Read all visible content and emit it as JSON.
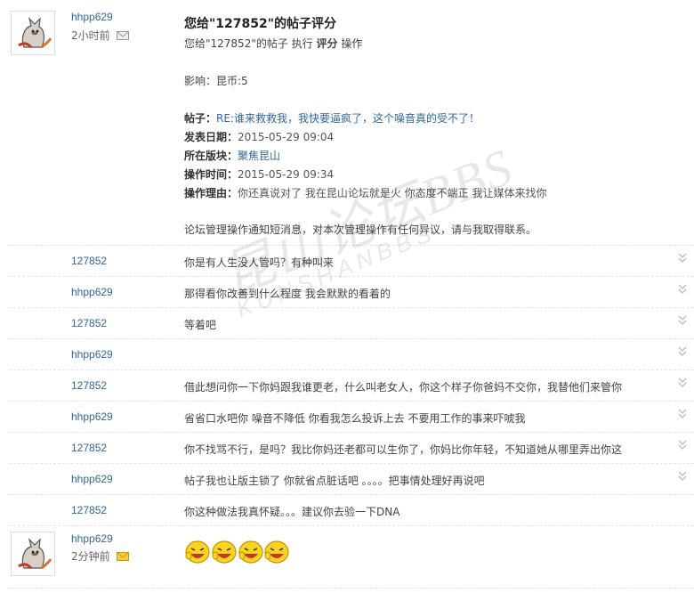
{
  "post1": {
    "username": "hhpp629",
    "time": "2小时前",
    "title": "您给\"127852\"的帖子评分",
    "subline_prefix": "您给\"127852\"的帖子 执行 ",
    "subline_action": "评分",
    "subline_suffix": " 操作",
    "impact": "影响：昆币:5",
    "fields": [
      {
        "key": "帖子：",
        "value": "RE:谁来救救我，我快要逼疯了，这个噪音真的受不了！",
        "link": true
      },
      {
        "key": "发表日期：",
        "value": "2015-05-29 09:04",
        "link": false
      },
      {
        "key": "所在版块：",
        "value": "聚焦昆山",
        "link": true
      },
      {
        "key": "操作时间：",
        "value": "2015-05-29 09:34",
        "link": false
      },
      {
        "key": "操作理由：",
        "value": "你还真说对了 我在昆山论坛就是火 你态度不端正 我让媒体来找你",
        "link": false
      }
    ],
    "notice": "论坛管理操作通知短消息，对本次管理操作有任何异议，请与我取得联系。"
  },
  "replies": [
    {
      "user": "127852",
      "text": "你是有人生没人管吗？有种叫来"
    },
    {
      "user": "hhpp629",
      "text": "那得看你改善到什么程度 我会默默的看着的"
    },
    {
      "user": "127852",
      "text": "等着吧"
    },
    {
      "user": "hhpp629",
      "text": ""
    },
    {
      "user": "127852",
      "text": "借此想问你一下你妈跟我谁更老，什么叫老女人，你这个样子你爸妈不交你，我替他们来管你"
    },
    {
      "user": "hhpp629",
      "text": "省省口水吧你 噪音不降低 你看我怎么投诉上去 不要用工作的事来吓唬我"
    },
    {
      "user": "127852",
      "text": "你不找骂不行，是吗？我比你妈还老都可以生你了，你妈比你年轻，不知道她从哪里弄出你这"
    },
    {
      "user": "hhpp629",
      "text": "帖子我也让版主锁了 你就省点脏话吧 。。。。把事情处理好再说吧"
    },
    {
      "user": "127852",
      "text": "你这种做法我真怀疑。。。建议你去验一下DNA"
    }
  ],
  "post2": {
    "username": "hhpp629",
    "time": "2分钟前",
    "emoji_count": 4
  },
  "watermark": {
    "line1": "昆山论坛BBS",
    "line2": "KUNSHANBBS"
  },
  "colors": {
    "link": "#336699",
    "chevron": "#bbbbbb",
    "mail_unread": "#f0b400"
  }
}
